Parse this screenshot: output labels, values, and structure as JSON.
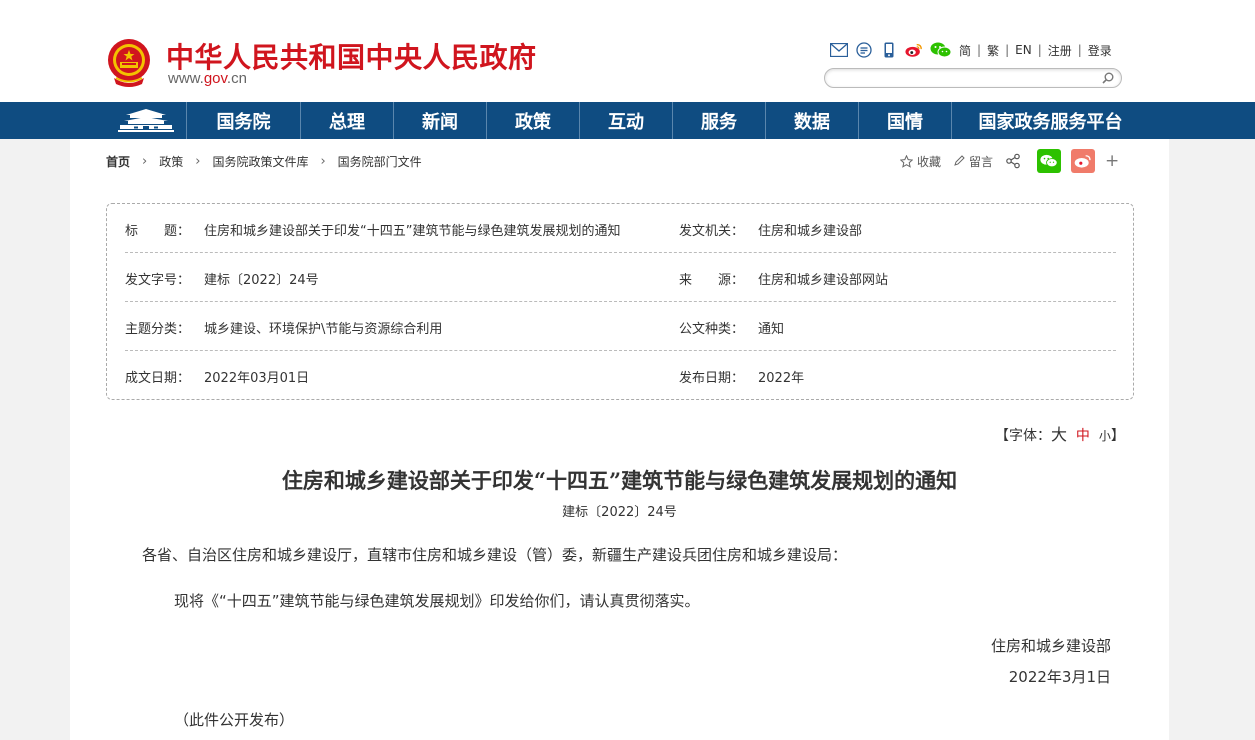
{
  "header": {
    "title": "中华人民共和国中央人民政府",
    "domain_prefix": "www.",
    "domain_brand": "gov",
    "domain_suffix": ".cn",
    "links": [
      "简",
      "繁",
      "EN",
      "注册",
      "登录"
    ],
    "search_placeholder": ""
  },
  "nav": {
    "items": [
      "国务院",
      "总理",
      "新闻",
      "政策",
      "互动",
      "服务",
      "数据",
      "国情",
      "国家政务服务平台"
    ]
  },
  "breadcrumb": [
    "首页",
    "政策",
    "国务院政策文件库",
    "国务院部门文件"
  ],
  "tools": {
    "favorite": "收藏",
    "comment": "留言",
    "more": "+"
  },
  "meta": {
    "title_label": "标　　题：",
    "title_value": "住房和城乡建设部关于印发“十四五”建筑节能与绿色建筑发展规划的通知",
    "issuer_label": "发文机关：",
    "issuer_value": "住房和城乡建设部",
    "docno_label": "发文字号：",
    "docno_value": "建标〔2022〕24号",
    "source_label": "来　　源：",
    "source_value": "住房和城乡建设部网站",
    "category_label": "主题分类：",
    "category_value": "城乡建设、环境保护\\节能与资源综合利用",
    "type_label": "公文种类：",
    "type_value": "通知",
    "written_label": "成文日期：",
    "written_value": "2022年03月01日",
    "published_label": "发布日期：",
    "published_value": "2022年"
  },
  "font_size": {
    "open": "【字体：",
    "large": "大",
    "medium": "中",
    "small": "小",
    "close": "】"
  },
  "article": {
    "title": "住房和城乡建设部关于印发“十四五”建筑节能与绿色建筑发展规划的通知",
    "doc_no": "建标〔2022〕24号",
    "salutation": "各省、自治区住房和城乡建设厅，直辖市住房和城乡建设（管）委，新疆生产建设兵团住房和城乡建设局：",
    "body": "现将《“十四五”建筑节能与绿色建筑发展规划》印发给你们，请认真贯彻落实。",
    "signer": "住房和城乡建设部",
    "date": "2022年3月1日",
    "note": "（此件公开发布）"
  },
  "colors": {
    "brand_red": "#d0151e",
    "nav_blue": "#0f4c81",
    "wechat_green": "#2dc100",
    "weibo_red": "#e6162d"
  }
}
